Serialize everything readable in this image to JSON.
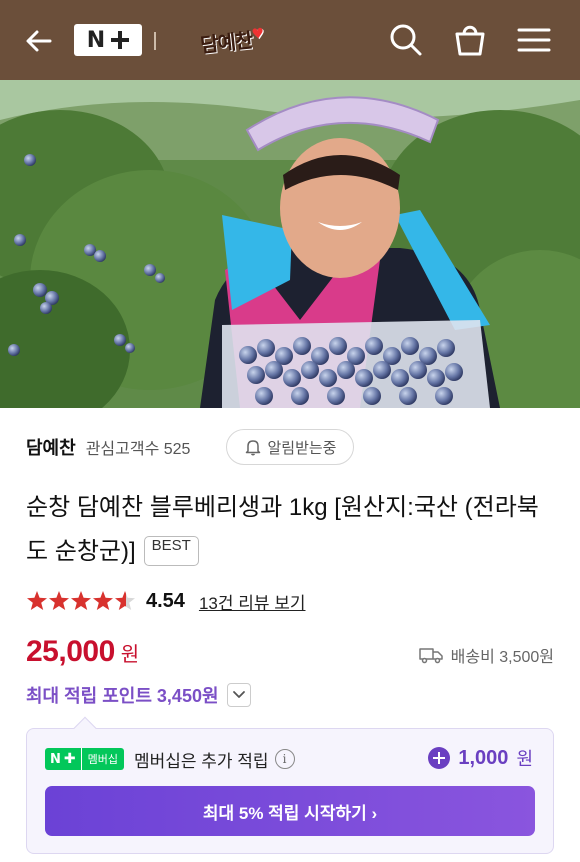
{
  "header": {
    "back_icon": "arrow-left-icon",
    "brand_badge": "N",
    "logo_text": "담예찬",
    "icons": [
      "search-icon",
      "shopping-bag-icon",
      "menu-icon"
    ],
    "bg_color": "#6b4f3a"
  },
  "seller": {
    "name": "담예찬",
    "fans_label": "관심고객수 525",
    "alarm_label": "알림받는중"
  },
  "product": {
    "title": "순창 담예찬 블루베리생과 1kg [원산지:국산 (전라북도 순창군)]",
    "badge": "BEST",
    "rating": {
      "score": "4.54",
      "stars": 4.54,
      "review_link": "13건 리뷰 보기"
    },
    "price": {
      "amount": "25,000",
      "unit": "원",
      "color": "#c8102e"
    },
    "shipping": "배송비 3,500원",
    "points_label": "최대 적립 포인트 3,450원"
  },
  "membership": {
    "badge_label": "멤버십",
    "text": "멤버십은 추가 적립",
    "bonus_amount": "1,000",
    "bonus_unit": "원",
    "cta_label": "최대 5% 적립 시작하기 ›",
    "accent_color": "#6b42d6"
  }
}
